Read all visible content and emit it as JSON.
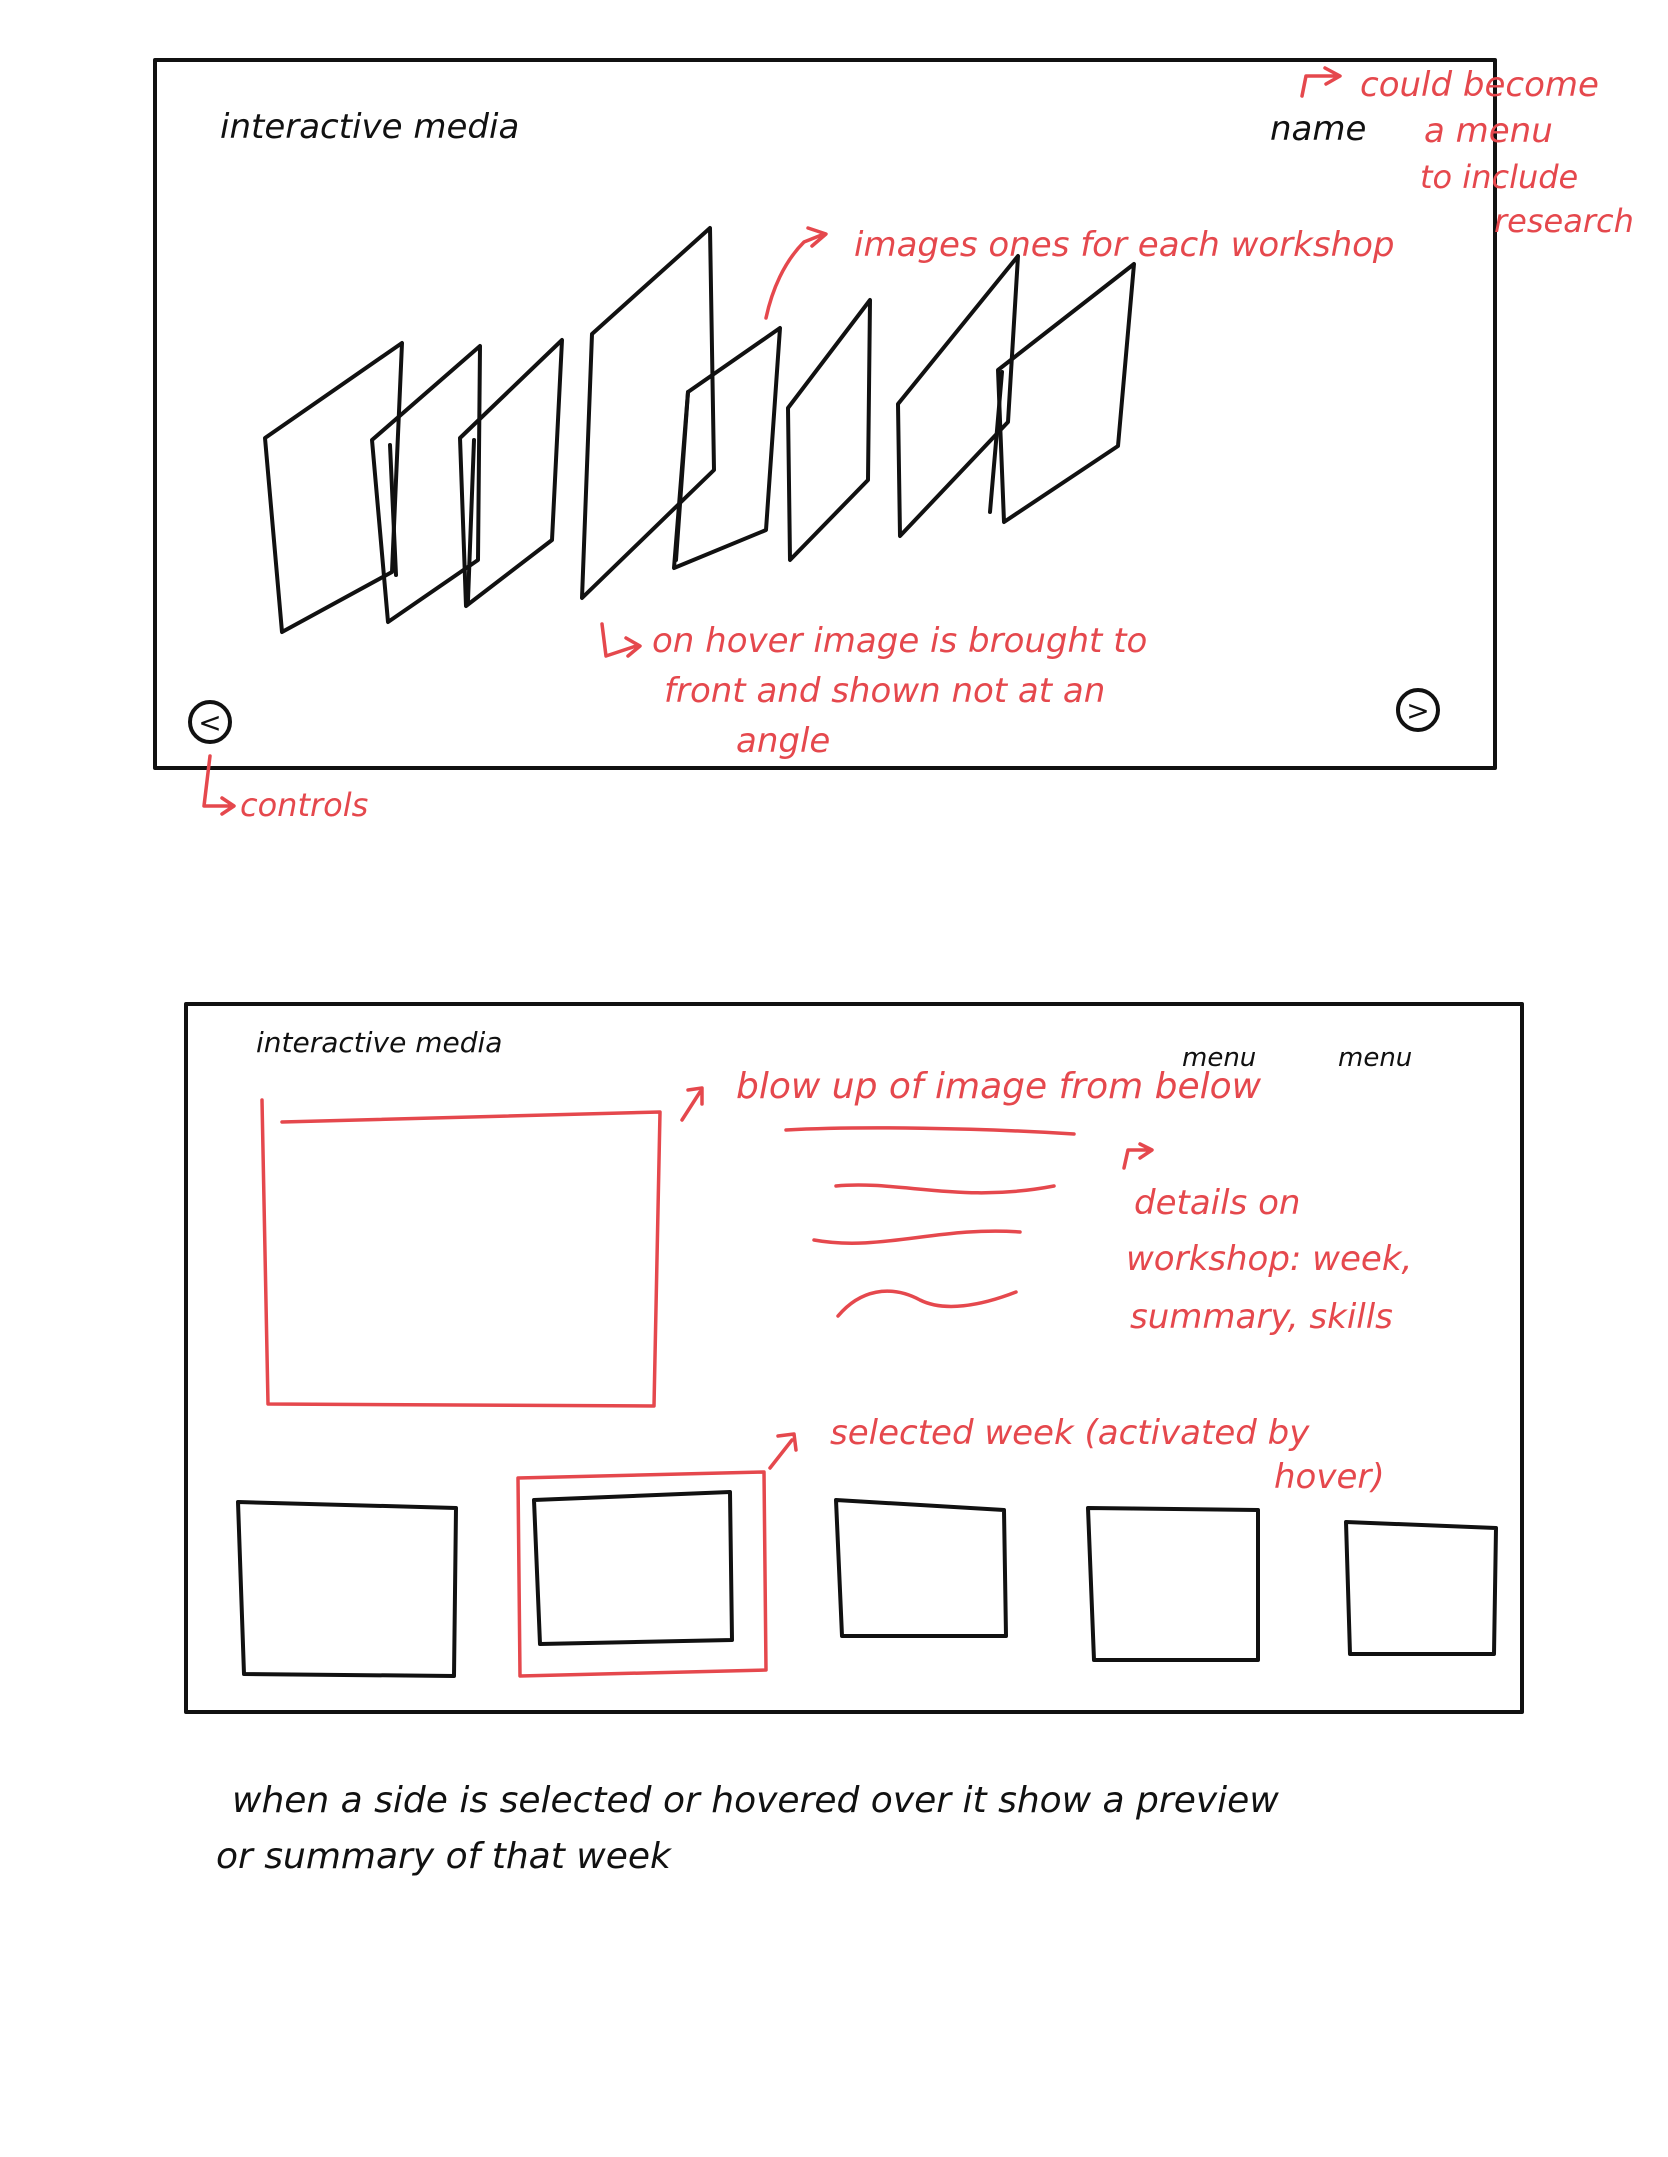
{
  "colors": {
    "ink": "#111111",
    "annotation": "#e5484d",
    "paper": "#ffffff"
  },
  "sketch1": {
    "title": "interactive media",
    "name_label": "name",
    "annotation_menu": [
      "could become",
      "a menu",
      "to include",
      "research"
    ],
    "annotation_images": "images ones for each workshop",
    "annotation_hover": [
      "on hover image is brought to",
      "front and shown not at an",
      "angle"
    ],
    "prev_control": "<",
    "next_control": ">",
    "annotation_controls": "controls"
  },
  "sketch2": {
    "title": "interactive media",
    "menu_items": [
      "menu",
      "menu"
    ],
    "annotation_blowup": "blow up of image from below",
    "annotation_details": [
      "details on",
      "workshop: week,",
      "summary, skills"
    ],
    "annotation_selected": [
      "selected week (activated by",
      "hover)"
    ]
  },
  "footer_note": [
    "when a side is selected or hovered over it show a preview",
    "or summary of that week"
  ]
}
